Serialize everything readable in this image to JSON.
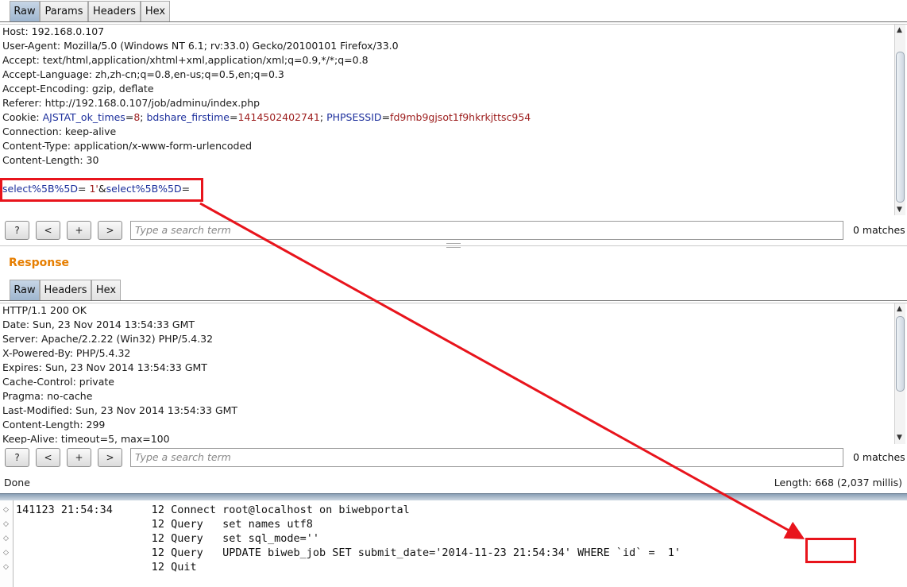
{
  "request": {
    "tabs": [
      "Raw",
      "Params",
      "Headers",
      "Hex"
    ],
    "active_tab": "Raw",
    "headers": [
      "Host: 192.168.0.107",
      "User-Agent: Mozilla/5.0 (Windows NT 6.1; rv:33.0) Gecko/20100101 Firefox/33.0",
      "Accept: text/html,application/xhtml+xml,application/xml;q=0.9,*/*;q=0.8",
      "Accept-Language: zh,zh-cn;q=0.8,en-us;q=0.5,en;q=0.3",
      "Accept-Encoding: gzip, deflate",
      "Referer: http://192.168.0.107/job/adminu/index.php"
    ],
    "cookie": {
      "prefix": "Cookie: ",
      "n1": "AJSTAT_ok_times",
      "v1": "8",
      "n2": "bdshare_firstime",
      "v2": "1414502402741",
      "n3": "PHPSESSID",
      "v3": "fd9mb9gjsot1f9hkrkjttsc954"
    },
    "headers2": [
      "Connection: keep-alive",
      "Content-Type: application/x-www-form-urlencoded",
      "Content-Length: 30"
    ],
    "body": {
      "p1": "select%5B%5D",
      "v1": " 1'",
      "amp": "&",
      "p2": "select%5B%5D",
      "v2": ""
    },
    "search": {
      "buttons": [
        "?",
        "<",
        "+",
        ">"
      ],
      "placeholder": "Type a search term",
      "matches": "0 matches"
    }
  },
  "response": {
    "title": "Response",
    "tabs": [
      "Raw",
      "Headers",
      "Hex"
    ],
    "active_tab": "Raw",
    "lines": [
      "HTTP/1.1 200 OK",
      "Date: Sun, 23 Nov 2014 13:54:33 GMT",
      "Server: Apache/2.2.22 (Win32) PHP/5.4.32",
      "X-Powered-By: PHP/5.4.32",
      "Expires: Sun, 23 Nov 2014 13:54:33 GMT",
      "Cache-Control: private",
      "Pragma: no-cache",
      "Last-Modified: Sun, 23 Nov 2014 13:54:33 GMT",
      "Content-Length: 299",
      "Keep-Alive: timeout=5, max=100"
    ],
    "search": {
      "buttons": [
        "?",
        "<",
        "+",
        ">"
      ],
      "placeholder": "Type a search term",
      "matches": "0 matches"
    }
  },
  "status": {
    "left": "Done",
    "right": "Length: 668 (2,037 millis)"
  },
  "log": {
    "lines": [
      "141123 21:54:34\t     12 Connect\troot@localhost on biwebportal",
      "\t\t     12 Query\tset names utf8",
      "\t\t     12 Query\tset sql_mode=''",
      "\t\t     12 Query\tUPDATE biweb_job SET submit_date='2014-11-23 21:54:34' WHERE `id` = ",
      "\t\t     12 Quit\t"
    ],
    "highlight_value": " 1'"
  },
  "colors": {
    "annotation": "#e8141c",
    "cookie_name": "#1c2f9c",
    "cookie_value": "#9c1c1c",
    "response_title": "#e67e00"
  }
}
